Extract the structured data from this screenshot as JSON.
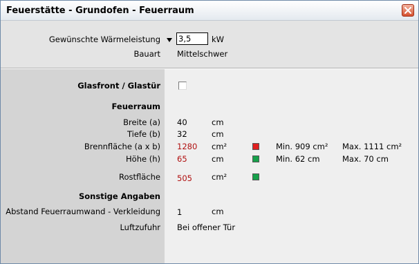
{
  "window": {
    "title": "Feuerstätte - Grundofen - Feuerraum"
  },
  "heat": {
    "label": "Gewünschte Wärmeleistung",
    "value": "3,5",
    "unit": "kW"
  },
  "bauart": {
    "label": "Bauart",
    "value": "Mittelschwer"
  },
  "glass": {
    "label": "Glasfront / Glastür",
    "checked": false
  },
  "feuerraum": {
    "heading": "Feuerraum",
    "rows": [
      {
        "label": "Breite (a)",
        "value": "40",
        "unit": "cm"
      },
      {
        "label": "Tiefe (b)",
        "value": "32",
        "unit": "cm"
      },
      {
        "label": "Brennfläche (a x b)",
        "value": "1280",
        "unit": "cm²",
        "indicator": "#e02020",
        "min": "Min. 909 cm²",
        "max": "Max. 1111 cm²"
      },
      {
        "label": "Höhe (h)",
        "value": "65",
        "unit": "cm",
        "indicator": "#16a04a",
        "min": "Min. 62 cm",
        "max": "Max. 70 cm"
      },
      {
        "label": "Rostfläche",
        "value": "505",
        "unit": "cm²",
        "indicator": "#16a04a"
      }
    ]
  },
  "sonstige": {
    "heading": "Sonstige Angaben",
    "abstand": {
      "label": "Abstand Feuerraumwand - Verkleidung",
      "value": "1",
      "unit": "cm"
    },
    "luftzufuhr": {
      "label": "Luftzufuhr",
      "value": "Bei offener Tür"
    }
  },
  "icons": {
    "close": "close-icon",
    "dropdown": "dropdown-arrow-icon"
  }
}
